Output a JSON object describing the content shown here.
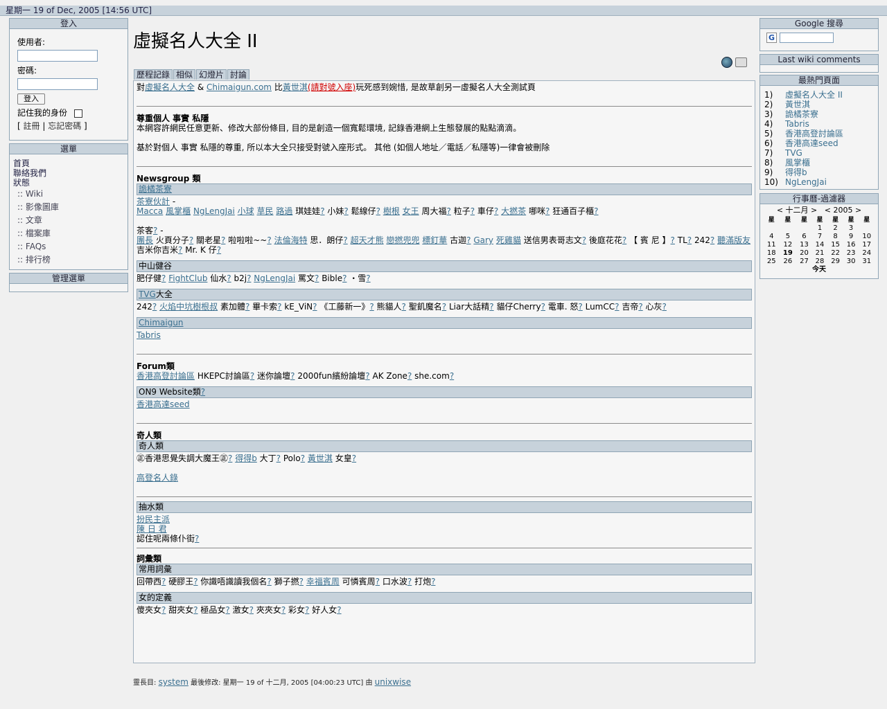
{
  "topbar": {
    "datetime": "星期一 19 of Dec, 2005 [14:56 UTC]"
  },
  "login": {
    "title": "登入",
    "user_label": "使用者:",
    "pass_label": "密碼:",
    "login_button": "登入",
    "remember_label": "記住我的身份",
    "register": "註冊",
    "forgot": "忘記密碼"
  },
  "menu": {
    "title": "選單",
    "links": [
      "首頁",
      "聯絡我們",
      "狀態"
    ],
    "sections": [
      ":: Wiki",
      ":: 影像圖庫",
      ":: 文章",
      ":: 檔案庫",
      ":: FAQs",
      ":: 排行榜"
    ]
  },
  "admin_menu": {
    "title": "管理選單"
  },
  "page": {
    "title": "虛擬名人大全 II",
    "tabs": [
      "歷程記錄",
      "相似",
      "幻燈片",
      "討論"
    ],
    "intro": {
      "pre": "對",
      "link1": "虛擬名人大全",
      "amp": " & ",
      "link2": "Chimaigun.com",
      "mid": " 比",
      "link3": "黃世淇",
      "red": "(請對號入座)",
      "post": "玩死感到婉惜, 是故草創另一虛擬名人大全測試頁"
    },
    "respect_heading": "尊重個人 事實 私隱",
    "respect_line1": "本網容許網民任意更新、修改大部份條目, 目的是創造一個寬鬆環境, 記錄香港網上生態發展的點點滴滴。",
    "respect_line2": "基於對個人 事實 私隱的尊重, 所以本大全只接受對號入座形式。 其他 (如個人地址／電話／私隱等)一律會被刪除",
    "newsgroup_heading": "Newsgroup 類",
    "cafe_header": "詭橘茶寮",
    "cafe_line1_link": "茶寮伙計",
    "cafe_line1_rest": " -",
    "cafe_line2": [
      {
        "t": "Macca",
        "type": "link"
      },
      {
        "t": " ",
        "type": "text"
      },
      {
        "t": "風掌櫃",
        "type": "link"
      },
      {
        "t": " ",
        "type": "text"
      },
      {
        "t": "NgLengJai",
        "type": "link"
      },
      {
        "t": " ",
        "type": "text"
      },
      {
        "t": "小球",
        "type": "link"
      },
      {
        "t": " ",
        "type": "text"
      },
      {
        "t": "草民",
        "type": "link"
      },
      {
        "t": " ",
        "type": "text"
      },
      {
        "t": "路過",
        "type": "link"
      },
      {
        "t": " 琪娃娃",
        "type": "text"
      },
      {
        "t": "?",
        "type": "q"
      },
      {
        "t": " 小妹",
        "type": "text"
      },
      {
        "t": "?",
        "type": "q"
      },
      {
        "t": " 鬆線仔",
        "type": "text"
      },
      {
        "t": "?",
        "type": "q"
      },
      {
        "t": " ",
        "type": "text"
      },
      {
        "t": "樹根",
        "type": "link"
      },
      {
        "t": " ",
        "type": "text"
      },
      {
        "t": "女王",
        "type": "link"
      },
      {
        "t": " 周大福",
        "type": "text"
      },
      {
        "t": "?",
        "type": "q"
      },
      {
        "t": " 粒子",
        "type": "text"
      },
      {
        "t": "?",
        "type": "q"
      },
      {
        "t": " 車仔",
        "type": "text"
      },
      {
        "t": "?",
        "type": "q"
      },
      {
        "t": " ",
        "type": "text"
      },
      {
        "t": "大撚茶",
        "type": "link"
      },
      {
        "t": " 哪咪",
        "type": "text"
      },
      {
        "t": "?",
        "type": "q"
      },
      {
        "t": " 狂通百子櫃",
        "type": "text"
      },
      {
        "t": "?",
        "type": "q"
      }
    ],
    "guest_label": "茶客",
    "guest_rest": " -",
    "guest_line": [
      {
        "t": "團長",
        "type": "link"
      },
      {
        "t": " 火頁分子",
        "type": "text"
      },
      {
        "t": "?",
        "type": "q"
      },
      {
        "t": " 關老星",
        "type": "text"
      },
      {
        "t": "?",
        "type": "q"
      },
      {
        "t": " 啦啦啦~~",
        "type": "text"
      },
      {
        "t": "?",
        "type": "q"
      },
      {
        "t": " ",
        "type": "text"
      },
      {
        "t": "法倫海特",
        "type": "link"
      },
      {
        "t": " 思．朗仔",
        "type": "text"
      },
      {
        "t": "?",
        "type": "q"
      },
      {
        "t": " ",
        "type": "text"
      },
      {
        "t": "超天才熊",
        "type": "link"
      },
      {
        "t": " ",
        "type": "text"
      },
      {
        "t": "戀撚兜兜",
        "type": "link"
      },
      {
        "t": " ",
        "type": "text"
      },
      {
        "t": "標釘華",
        "type": "link"
      },
      {
        "t": " 古迦",
        "type": "text"
      },
      {
        "t": "?",
        "type": "q"
      },
      {
        "t": " ",
        "type": "text"
      },
      {
        "t": "Gary",
        "type": "link"
      },
      {
        "t": " ",
        "type": "text"
      },
      {
        "t": "死雞貓",
        "type": "link"
      },
      {
        "t": " 送信男表哥志文",
        "type": "text"
      },
      {
        "t": "?",
        "type": "q"
      },
      {
        "t": " 後庭花花",
        "type": "text"
      },
      {
        "t": "?",
        "type": "q"
      },
      {
        "t": " 【 賓 尼 】",
        "type": "text"
      },
      {
        "t": "?",
        "type": "q"
      },
      {
        "t": " TL",
        "type": "text"
      },
      {
        "t": "?",
        "type": "q"
      },
      {
        "t": " 242",
        "type": "text"
      },
      {
        "t": "?",
        "type": "q"
      },
      {
        "t": " ",
        "type": "text"
      },
      {
        "t": "聽滿版友",
        "type": "link"
      },
      {
        "t": " 吉米你吉米",
        "type": "text"
      },
      {
        "t": "?",
        "type": "q"
      },
      {
        "t": " Mr. K 仔",
        "type": "text"
      },
      {
        "t": "?",
        "type": "q"
      }
    ],
    "zhongshan_header": "中山健谷",
    "zhongshan_line": [
      {
        "t": "肥仔健",
        "type": "text"
      },
      {
        "t": "?",
        "type": "q"
      },
      {
        "t": " ",
        "type": "text"
      },
      {
        "t": "FightClub",
        "type": "link"
      },
      {
        "t": " 仙水",
        "type": "text"
      },
      {
        "t": "?",
        "type": "q"
      },
      {
        "t": " b2j",
        "type": "text"
      },
      {
        "t": "?",
        "type": "q"
      },
      {
        "t": " ",
        "type": "text"
      },
      {
        "t": "NgLengJai",
        "type": "link"
      },
      {
        "t": " 罵文",
        "type": "text"
      },
      {
        "t": "?",
        "type": "q"
      },
      {
        "t": " Bible",
        "type": "text"
      },
      {
        "t": "?",
        "type": "q"
      },
      {
        "t": " ・雪",
        "type": "text"
      },
      {
        "t": "?",
        "type": "q"
      }
    ],
    "tvg_header_link": "TVG",
    "tvg_header_rest": "大全",
    "tvg_line": [
      {
        "t": "242",
        "type": "text"
      },
      {
        "t": "?",
        "type": "q"
      },
      {
        "t": " ",
        "type": "text"
      },
      {
        "t": "火焰中坑樹根叔",
        "type": "link"
      },
      {
        "t": " 素加體",
        "type": "text"
      },
      {
        "t": "?",
        "type": "q"
      },
      {
        "t": " 畢卡索",
        "type": "text"
      },
      {
        "t": "?",
        "type": "q"
      },
      {
        "t": " kE_ViN",
        "type": "text"
      },
      {
        "t": "?",
        "type": "q"
      },
      {
        "t": " 《工藤新一》",
        "type": "text"
      },
      {
        "t": "?",
        "type": "q"
      },
      {
        "t": " 熊貓人",
        "type": "text"
      },
      {
        "t": "?",
        "type": "q"
      },
      {
        "t": " 聖飢魔名",
        "type": "text"
      },
      {
        "t": "?",
        "type": "q"
      },
      {
        "t": " Liar大話精",
        "type": "text"
      },
      {
        "t": "?",
        "type": "q"
      },
      {
        "t": " 貓仔Cherry",
        "type": "text"
      },
      {
        "t": "?",
        "type": "q"
      },
      {
        "t": " 電車. 怒",
        "type": "text"
      },
      {
        "t": "?",
        "type": "q"
      },
      {
        "t": " LumCC",
        "type": "text"
      },
      {
        "t": "?",
        "type": "q"
      },
      {
        "t": " 吉帝",
        "type": "text"
      },
      {
        "t": "?",
        "type": "q"
      },
      {
        "t": " 心灰",
        "type": "text"
      },
      {
        "t": "?",
        "type": "q"
      }
    ],
    "chimaigun_header": "Chimaigun",
    "tabris_link": "Tabris",
    "forum_heading": "Forum類",
    "forum_line": [
      {
        "t": "香港高登討論區",
        "type": "link"
      },
      {
        "t": " HKEPC討論區",
        "type": "text"
      },
      {
        "t": "?",
        "type": "q"
      },
      {
        "t": " 迷你論壇",
        "type": "text"
      },
      {
        "t": "?",
        "type": "q"
      },
      {
        "t": " 2000fun繽紛論壇",
        "type": "text"
      },
      {
        "t": "?",
        "type": "q"
      },
      {
        "t": " AK Zone",
        "type": "text"
      },
      {
        "t": "?",
        "type": "q"
      },
      {
        "t": " she.com",
        "type": "text"
      },
      {
        "t": "?",
        "type": "q"
      }
    ],
    "on9_header": "ON9 Website類",
    "on9_link": "香港高達seed",
    "weird_heading": "奇人類",
    "weird_header": "奇人類",
    "weird_line": [
      {
        "t": "㊣香港思覺失調大魔王㊣",
        "type": "text"
      },
      {
        "t": "?",
        "type": "q"
      },
      {
        "t": " ",
        "type": "text"
      },
      {
        "t": "得得b",
        "type": "link"
      },
      {
        "t": " 大丁",
        "type": "text"
      },
      {
        "t": "?",
        "type": "q"
      },
      {
        "t": " Polo",
        "type": "text"
      },
      {
        "t": "?",
        "type": "q"
      },
      {
        "t": " ",
        "type": "text"
      },
      {
        "t": "黃世淇",
        "type": "link"
      },
      {
        "t": " 女皇",
        "type": "text"
      },
      {
        "t": "?",
        "type": "q"
      }
    ],
    "golden_link": "高登名人錄",
    "water_header": "抽水類",
    "water_link1": "扮民主派",
    "water_link2": "陳 日 君",
    "water_line": [
      {
        "t": "認住呢兩條仆街",
        "type": "text"
      },
      {
        "t": "?",
        "type": "q"
      }
    ],
    "vocab_heading": "詞彙類",
    "vocab_header": "常用詞彙",
    "vocab_line": [
      {
        "t": "回帶西",
        "type": "text"
      },
      {
        "t": "?",
        "type": "q"
      },
      {
        "t": " 硬膠王",
        "type": "text"
      },
      {
        "t": "?",
        "type": "q"
      },
      {
        "t": " 你識唔識讀我個名",
        "type": "text"
      },
      {
        "t": "?",
        "type": "q"
      },
      {
        "t": " 獅子撚",
        "type": "text"
      },
      {
        "t": "?",
        "type": "q"
      },
      {
        "t": " ",
        "type": "text"
      },
      {
        "t": "幸福賓周",
        "type": "link"
      },
      {
        "t": " 可憐賓周",
        "type": "text"
      },
      {
        "t": "?",
        "type": "q"
      },
      {
        "t": " 口水波",
        "type": "text"
      },
      {
        "t": "?",
        "type": "q"
      },
      {
        "t": " 打炮",
        "type": "text"
      },
      {
        "t": "?",
        "type": "q"
      }
    ],
    "girl_header": "女的定義",
    "girl_line": [
      {
        "t": "傻夾女",
        "type": "text"
      },
      {
        "t": "?",
        "type": "q"
      },
      {
        "t": " 甜夾女",
        "type": "text"
      },
      {
        "t": "?",
        "type": "q"
      },
      {
        "t": " 極品女",
        "type": "text"
      },
      {
        "t": "?",
        "type": "q"
      },
      {
        "t": " 激女",
        "type": "text"
      },
      {
        "t": "?",
        "type": "q"
      },
      {
        "t": " 夾夾女",
        "type": "text"
      },
      {
        "t": "?",
        "type": "q"
      },
      {
        "t": " 彩女",
        "type": "text"
      },
      {
        "t": "?",
        "type": "q"
      },
      {
        "t": " 好人女",
        "type": "text"
      },
      {
        "t": "?",
        "type": "q"
      }
    ]
  },
  "footer": {
    "prefix": "靈長目:",
    "author": "system",
    "middle": " 最後修改: 星期一 19 of 十二月, 2005 [04:00:23 UTC] 由 ",
    "editor": "unixwise"
  },
  "google": {
    "title": "Google 搜尋",
    "logo": "G"
  },
  "wiki_comments": {
    "title": "Last wiki comments"
  },
  "popular": {
    "title": "最熱門頁面",
    "items": [
      {
        "n": "1)",
        "t": "虛擬名人大全 II"
      },
      {
        "n": "2)",
        "t": "黃世淇"
      },
      {
        "n": "3)",
        "t": "詭橘茶寮"
      },
      {
        "n": "4)",
        "t": "Tabris"
      },
      {
        "n": "5)",
        "t": "香港高登討論區"
      },
      {
        "n": "6)",
        "t": "香港高達seed"
      },
      {
        "n": "7)",
        "t": "TVG"
      },
      {
        "n": "8)",
        "t": "風掌櫃"
      },
      {
        "n": "9)",
        "t": "得得b"
      },
      {
        "n": "10)",
        "t": "NgLengJai"
      }
    ]
  },
  "calendar": {
    "title": "行事曆-過濾器",
    "month_nav": "< 十二月 >",
    "year_nav": "< 2005 >",
    "weekdays": [
      "星",
      "星",
      "星",
      "星",
      "星",
      "星",
      "星"
    ],
    "weeks": [
      [
        "",
        "",
        "",
        "1",
        "2",
        "3",
        ""
      ],
      [
        "4",
        "5",
        "6",
        "7",
        "8",
        "9",
        "10"
      ],
      [
        "11",
        "12",
        "13",
        "14",
        "15",
        "16",
        "17"
      ],
      [
        "18",
        "19",
        "20",
        "21",
        "22",
        "23",
        "24"
      ],
      [
        "25",
        "26",
        "27",
        "28",
        "29",
        "30",
        "31"
      ]
    ],
    "today": "今天"
  }
}
